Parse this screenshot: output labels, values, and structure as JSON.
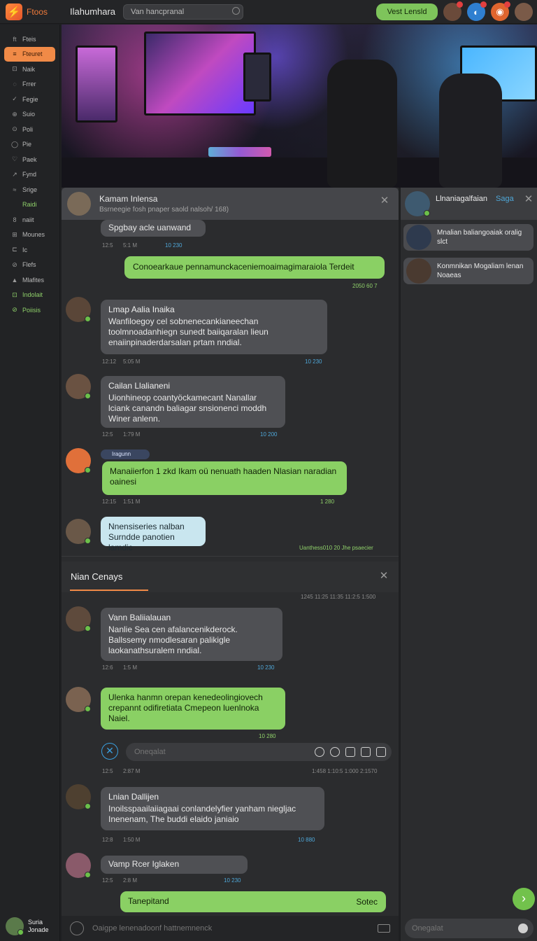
{
  "topbar": {
    "logo_text": "Ftoos",
    "title": "Ilahumhara",
    "search_value": "Van hancpranal",
    "action_button": "Vest Lensld"
  },
  "sidebar": {
    "items": [
      {
        "icon": "ft",
        "label": "Fteis"
      },
      {
        "icon": "≡",
        "label": "Fteuret"
      },
      {
        "icon": "⊡",
        "label": "Naik"
      },
      {
        "icon": "◌",
        "label": "Frrer"
      },
      {
        "icon": "✓",
        "label": "Fegie"
      },
      {
        "icon": "⊕",
        "label": "Suio"
      },
      {
        "icon": "⊙",
        "label": "Poli"
      },
      {
        "icon": "◯",
        "label": "Pie"
      },
      {
        "icon": "♡",
        "label": "Paek"
      },
      {
        "icon": "↗",
        "label": "Fynd"
      },
      {
        "icon": "≈",
        "label": "Srige"
      },
      {
        "icon": "",
        "label": "Raidi"
      },
      {
        "icon": "8",
        "label": "naiit"
      },
      {
        "icon": "⊞",
        "label": "Mounes"
      },
      {
        "icon": "⊏",
        "label": "Ic"
      },
      {
        "icon": "⊘",
        "label": "Flefs"
      },
      {
        "icon": "▲",
        "label": "Mlafites"
      },
      {
        "icon": "⊡",
        "label": "Indolait"
      },
      {
        "icon": "⊘",
        "label": "Poiisis"
      }
    ],
    "user_name": "Suria Jonade"
  },
  "chat1": {
    "header_name": "Kamam Inlensa",
    "header_sub": "Bsrneegie fosh pnaper saold nalsoh/ 168)",
    "messages": [
      {
        "text": "Spgbay acle uanwand",
        "time": "12:5",
        "time2": "5:1 M",
        "stamp": "10 230"
      },
      {
        "text": "Conoearkaue pennamunckaceniemoaimagimaraiola Terdeit",
        "stamp": "2050 60 7"
      },
      {
        "name": "Lmap Aalia Inaika",
        "text": "Wanfiloegoy cel sobnenecankianeechan toolmnoadanhiegn sunedt baiiqaralan lieun enaiinpinaderdarsalan prtam nndial.",
        "time": "12:12",
        "time2": "5:05 M",
        "stamp": "10 230"
      },
      {
        "name": "Cailan Llalianeni",
        "text": "Uionhineop coantyöckamecant Nanallar lciank canandn baliagar snsionenci moddh Winer anlenn.",
        "time": "12:5",
        "time2": "1:79 M",
        "stamp": "10 200"
      },
      {
        "tag": "Iragunn",
        "text": "Manaiierfon 1 zkd Ikam oü nenuath haaden Nlasian naradian oainesi",
        "time": "12:15",
        "time2": "1:51 M",
        "stamp": "1 280"
      },
      {
        "text": "Nnensiseries nalban Surndde panotien lamdic",
        "stamp": "Uanthess010  20 Jhe psaecier"
      }
    ]
  },
  "chat2": {
    "header_name": "Nian Cenays",
    "header_stamp": "1245  11:25  11:35  11:2:5  1:500",
    "messages": [
      {
        "name": "Vann Baliialauan",
        "text": "Nanlie Sea cen afalancenikderock. Ballssemy nmodlesaran palikigle laokanathsuralem nndial.",
        "time": "12:6",
        "time2": "1:5 M",
        "stamp": "10 230"
      },
      {
        "text": "Ulenka hanmn orepan kenedeolingiovech crepannt odifiretiata Cmepeon luenlnoka Naiel.",
        "stamp": "10 280"
      },
      {
        "time": "12:5",
        "time2": "2:87 M",
        "stamp": "1:458  1:10:5  1:000  2:1570"
      },
      {
        "name": "Lnian Dallijen",
        "text": "Inoilsspaailaiiagaai conlandelyfier yanham niegljac Inenenam, The buddi elaido janiaio",
        "time": "12:8",
        "time2": "1:50 M",
        "stamp": "10 880"
      },
      {
        "name": "Vamp Rcer Iglaken",
        "time": "12:5",
        "time2": "2:8 M",
        "stamp": "10 230"
      },
      {
        "text": "Tanepitand",
        "tail": "Sotec"
      }
    ],
    "reply_placeholder": "Oneqalat",
    "bottom_placeholder": "Oaigpe lenenadoonf hattnemnenck"
  },
  "right": {
    "header_name": "Llnaniagalfaian",
    "header_link": "Saga",
    "items": [
      {
        "text": "Mnalian baliangoaiak oralig slct"
      },
      {
        "text": "Konmnikan Mogaliam lenan Noaeas"
      }
    ],
    "bottom_placeholder": "Onegalat"
  },
  "colors": {
    "accent": "#f08a47",
    "green": "#8ad064",
    "bubble_grey": "#4f5054",
    "background": "#2b2c2e"
  }
}
